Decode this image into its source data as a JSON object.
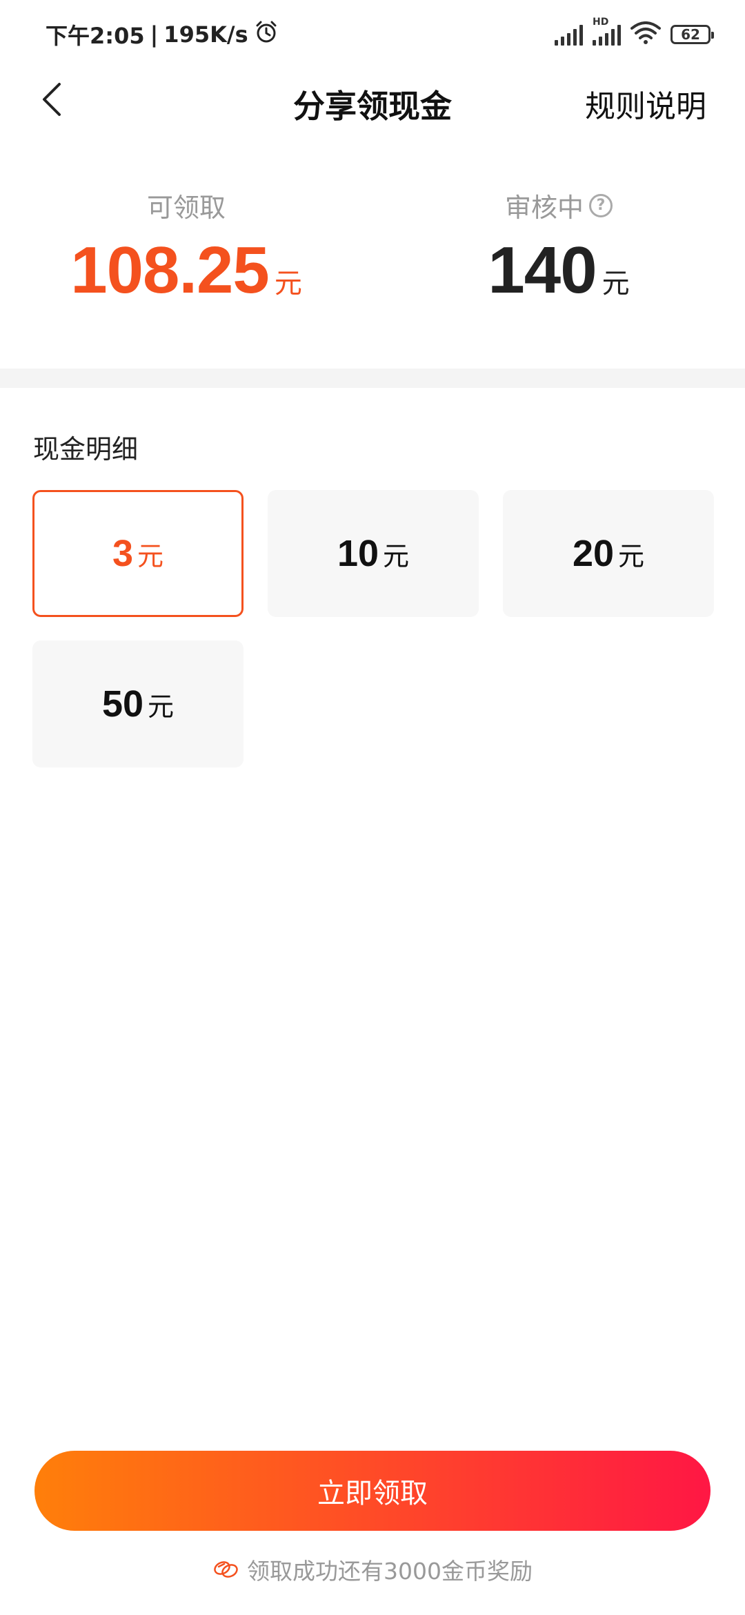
{
  "status_bar": {
    "time": "下午2:05",
    "separator": "|",
    "speed": "195K/s",
    "hd": "HD",
    "battery": "62"
  },
  "header": {
    "title": "分享领现金",
    "rules": "规则说明"
  },
  "summary": {
    "available_label": "可领取",
    "available_amount": "108.25",
    "available_unit": "元",
    "review_label": "审核中",
    "review_amount": "140",
    "review_unit": "元",
    "help_icon": "?"
  },
  "section_title": "现金明细",
  "options": [
    {
      "value": "3",
      "unit": "元",
      "selected": true
    },
    {
      "value": "10",
      "unit": "元",
      "selected": false
    },
    {
      "value": "20",
      "unit": "元",
      "selected": false
    },
    {
      "value": "50",
      "unit": "元",
      "selected": false
    }
  ],
  "claim_button": "立即领取",
  "footer_note": "领取成功还有3000金币奖励",
  "colors": {
    "accent": "#f4511e",
    "gradient_start": "#ff7f0a",
    "gradient_end": "#ff1744"
  }
}
